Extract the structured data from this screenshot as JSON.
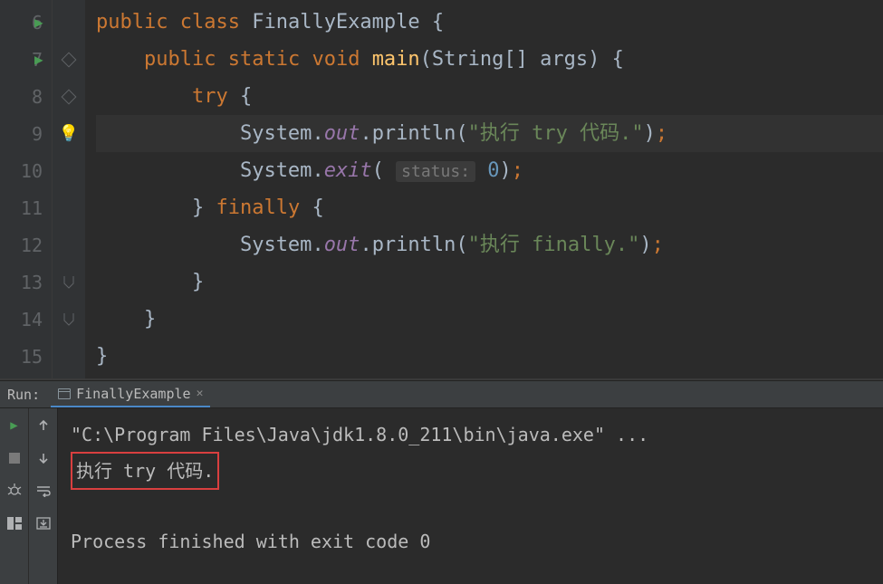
{
  "editor": {
    "lines": [
      {
        "num": "6"
      },
      {
        "num": "7"
      },
      {
        "num": "8"
      },
      {
        "num": "9"
      },
      {
        "num": "10"
      },
      {
        "num": "11"
      },
      {
        "num": "12"
      },
      {
        "num": "13"
      },
      {
        "num": "14"
      },
      {
        "num": "15"
      }
    ],
    "tokens": {
      "public": "public",
      "class": "class",
      "className": "FinallyExample",
      "static": "static",
      "void": "void",
      "main": "main",
      "mainParams": "(String[] args)",
      "try": "try",
      "finally": "finally",
      "system": "System",
      "out": "out",
      "println": "println",
      "exit": "exit",
      "str1": "\"执行 try 代码.\"",
      "str2": "\"执行 finally.\"",
      "paramHint": "status:",
      "zero": "0"
    }
  },
  "run": {
    "label": "Run:",
    "tabName": "FinallyExample",
    "output": {
      "cmd": "\"C:\\Program Files\\Java\\jdk1.8.0_211\\bin\\java.exe\" ...",
      "line1": "执行 try 代码.",
      "exit": "Process finished with exit code 0"
    }
  }
}
